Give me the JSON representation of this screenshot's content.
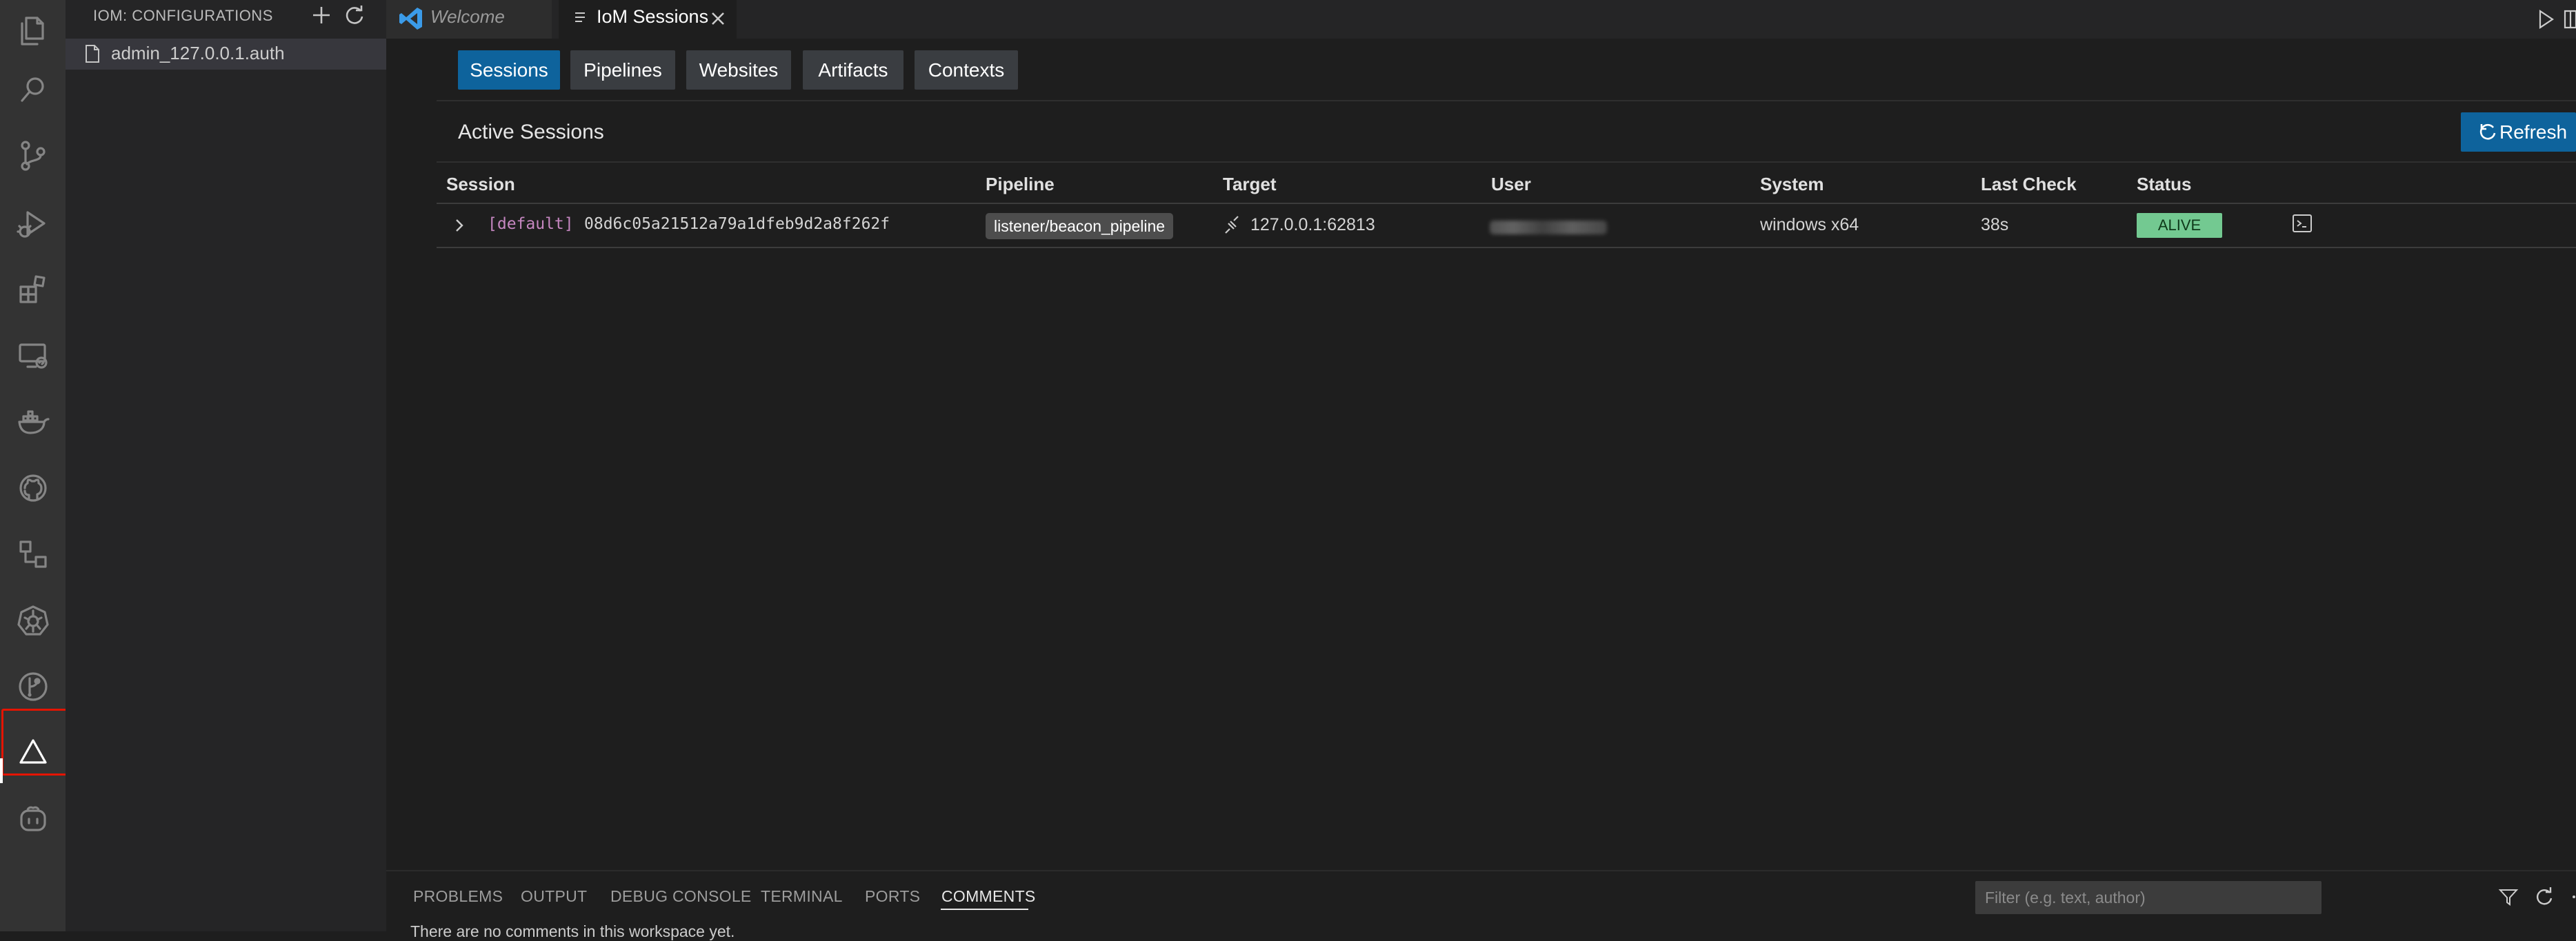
{
  "sidebar": {
    "title": "IOM: CONFIGURATIONS",
    "items": [
      {
        "label": "admin_127.0.0.1.auth"
      }
    ]
  },
  "activity_bar": {
    "icons": [
      "explorer-icon",
      "search-icon",
      "source-control-icon",
      "run-debug-icon",
      "extensions-icon",
      "remote-explorer-icon",
      "docker-icon",
      "github-icon",
      "connections-icon",
      "kubernetes-icon",
      "git-graph-icon",
      "iom-triangle-icon",
      "copilot-icon"
    ],
    "active": "iom-triangle-icon",
    "highlight_color": "#e51400"
  },
  "editor_tabs": [
    {
      "label": "Welcome",
      "active": false
    },
    {
      "label": "IoM Sessions",
      "active": true
    }
  ],
  "subtabs": [
    {
      "label": "Sessions",
      "active": true
    },
    {
      "label": "Pipelines",
      "active": false
    },
    {
      "label": "Websites",
      "active": false
    },
    {
      "label": "Artifacts",
      "active": false
    },
    {
      "label": "Contexts",
      "active": false
    }
  ],
  "section": {
    "title": "Active Sessions",
    "refresh_label": "Refresh"
  },
  "table": {
    "columns": [
      "Session",
      "Pipeline",
      "Target",
      "User",
      "System",
      "Last Check",
      "Status"
    ],
    "rows": [
      {
        "session_tag": "[default]",
        "session_id": "08d6c05a21512a79a1dfeb9d2a8f262f",
        "pipeline": "listener/beacon_pipeline",
        "target": "127.0.0.1:62813",
        "system": "windows x64",
        "last_check": "38s",
        "status": "ALIVE"
      }
    ]
  },
  "panel": {
    "tabs": [
      "PROBLEMS",
      "OUTPUT",
      "DEBUG CONSOLE",
      "TERMINAL",
      "PORTS",
      "COMMENTS"
    ],
    "active_tab": "COMMENTS",
    "filter_placeholder": "Filter (e.g. text, author)",
    "text": "There are no comments in this workspace yet."
  },
  "colors": {
    "accent": "#0e639c",
    "status_alive": "#73c991",
    "session_tag": "#c586c0"
  }
}
